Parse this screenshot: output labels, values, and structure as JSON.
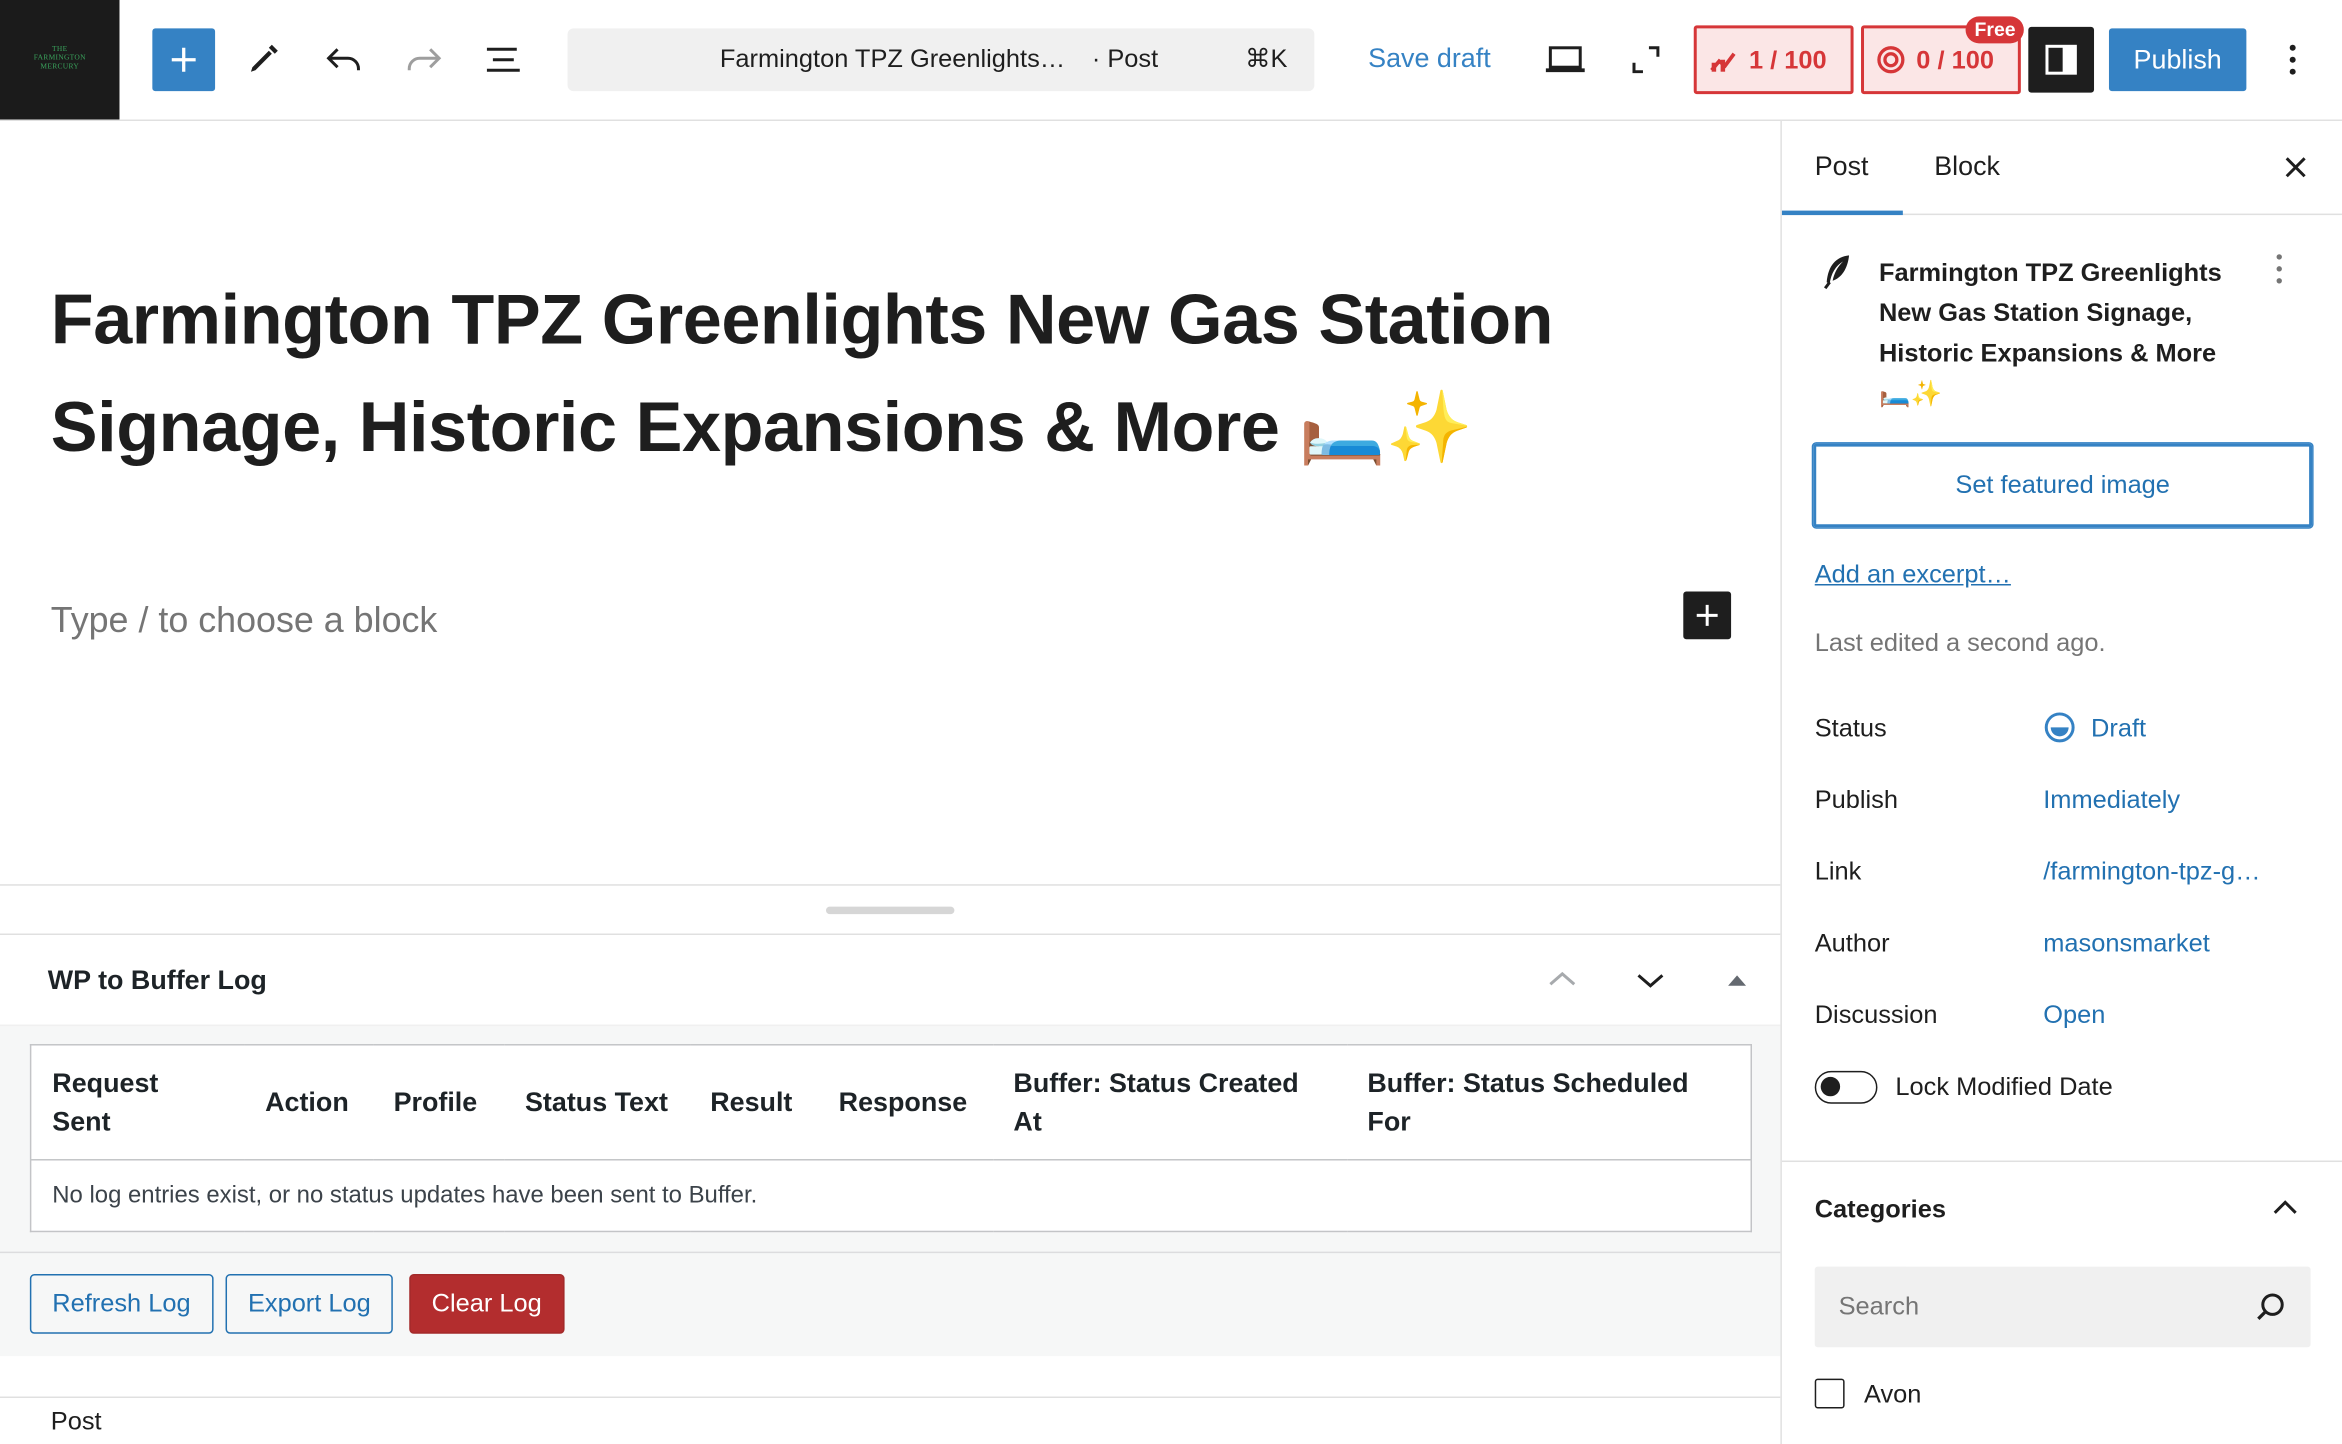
{
  "site": {
    "logo_lines": [
      "THE",
      "FARMINGTON",
      "MERCURY"
    ]
  },
  "toolbar": {
    "document_title": "Farmington TPZ Greenlights…",
    "document_type": "· Post",
    "shortcut": "⌘K",
    "save_draft": "Save draft",
    "publish": "Publish",
    "badge_a_value": "1 / 100",
    "badge_b_value": "0 / 100",
    "badge_free": "Free"
  },
  "editor": {
    "post_title": "Farmington TPZ Greenlights New Gas Station Signage, Historic Expansions & More 🛏️✨",
    "block_placeholder": "Type / to choose a block"
  },
  "metabox": {
    "title": "WP to Buffer Log",
    "columns": [
      "Request Sent",
      "Action",
      "Profile",
      "Status Text",
      "Result",
      "Response",
      "Buffer: Status Created At",
      "Buffer: Status Scheduled For"
    ],
    "empty_message": "No log entries exist, or no status updates have been sent to Buffer.",
    "refresh": "Refresh Log",
    "export": "Export Log",
    "clear": "Clear Log"
  },
  "footer": {
    "breadcrumb": "Post"
  },
  "sidebar": {
    "tabs": [
      "Post",
      "Block"
    ],
    "active_tab": "Post",
    "post_title": "Farmington TPZ Greenlights New Gas Station Signage, Historic Expansions & More 🛏️✨",
    "featured_image": "Set featured image",
    "excerpt": "Add an excerpt…",
    "last_edited": "Last edited a second ago.",
    "rows": [
      {
        "label": "Status",
        "value": "Draft"
      },
      {
        "label": "Publish",
        "value": "Immediately"
      },
      {
        "label": "Link",
        "value": "/farmington-tpz-g…"
      },
      {
        "label": "Author",
        "value": "masonsmarket"
      },
      {
        "label": "Discussion",
        "value": "Open"
      }
    ],
    "lock_modified_date": "Lock Modified Date",
    "categories": {
      "title": "Categories",
      "search_placeholder": "Search",
      "items": [
        "Avon"
      ]
    }
  },
  "colors": {
    "accent": "#3582c4",
    "danger": "#d63638",
    "clear_button": "#b32d2e"
  }
}
